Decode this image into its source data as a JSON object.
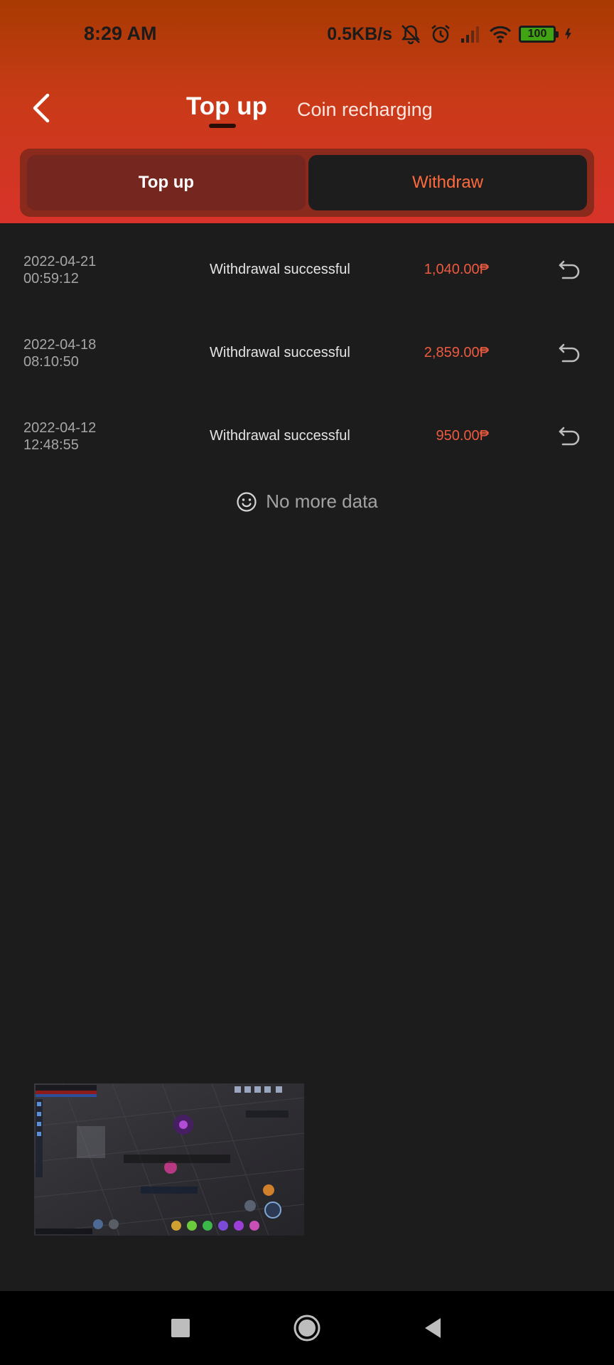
{
  "status_bar": {
    "time": "8:29 AM",
    "net_speed": "0.5KB/s",
    "battery": "100",
    "icons": [
      "mute-bell-icon",
      "alarm-icon",
      "signal-icon",
      "wifi-icon",
      "battery-icon",
      "charging-bolt-icon"
    ]
  },
  "header": {
    "tabs": [
      {
        "label": "Top up",
        "active": true
      },
      {
        "label": "Coin recharging",
        "active": false
      }
    ],
    "back_icon": "chevron-left-icon"
  },
  "segmented": {
    "options": [
      {
        "label": "Top up",
        "active": true
      },
      {
        "label": "Withdraw",
        "active": false
      }
    ]
  },
  "records": [
    {
      "date": "2022-04-21",
      "time": "00:59:12",
      "status": "Withdrawal successful",
      "amount": "1,040.00₱"
    },
    {
      "date": "2022-04-18",
      "time": "08:10:50",
      "status": "Withdrawal successful",
      "amount": "2,859.00₱"
    },
    {
      "date": "2022-04-12",
      "time": "12:48:55",
      "status": "Withdrawal successful",
      "amount": "950.00₱"
    }
  ],
  "empty_state": {
    "icon": "smiley-icon",
    "text": "No more data"
  },
  "colors": {
    "header_top": "#a83a02",
    "header_bottom": "#d8332a",
    "accent": "#ed5a3f",
    "background": "#1c1c1c"
  },
  "floating_window": {
    "content": "game-screenshot-thumbnail"
  },
  "system_nav": {
    "buttons": [
      "recent-apps-icon",
      "home-icon",
      "back-triangle-icon"
    ]
  }
}
